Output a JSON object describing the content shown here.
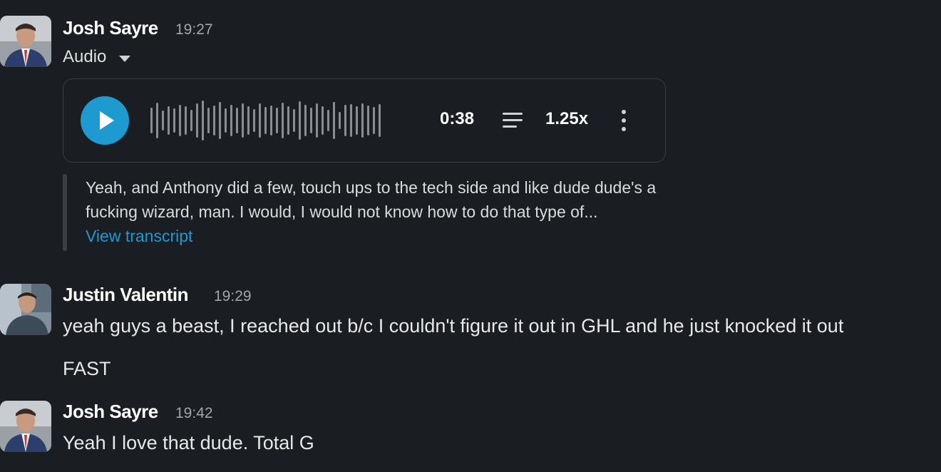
{
  "messages": [
    {
      "author": "Josh Sayre",
      "time": "19:27",
      "attachment_label": "Audio",
      "player": {
        "duration": "0:38",
        "speed": "1.25x"
      },
      "transcript": {
        "line1": "Yeah, and Anthony did a few, touch ups to the tech side and like dude dude's a",
        "line2": "fucking wizard, man. I would, I would not know how to do that type of...",
        "link": "View transcript"
      }
    },
    {
      "author": "Justin Valentin",
      "time": "19:29",
      "text": "yeah guys a beast, I reached out b/c I couldn't figure it out in GHL and he just knocked it out",
      "text2": "FAST"
    },
    {
      "author": "Josh Sayre",
      "time": "19:42",
      "text": "Yeah I love that dude. Total G"
    }
  ],
  "colors": {
    "background": "#1a1d21",
    "accent": "#1d9bd1",
    "muted": "#a4a5a8"
  },
  "icons": [
    "play-icon",
    "transcript-lines-icon",
    "more-vertical-icon",
    "chevron-down-icon"
  ]
}
